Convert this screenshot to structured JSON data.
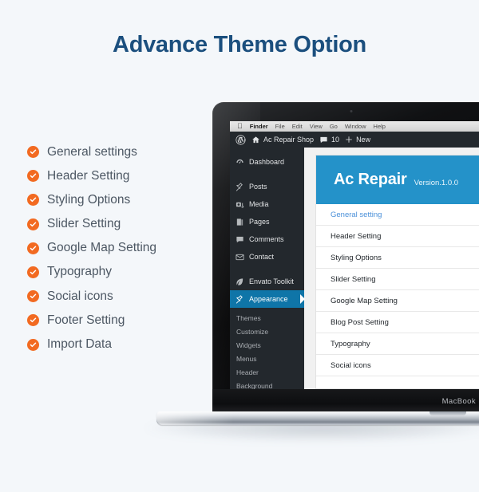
{
  "header": {
    "title": "Advance Theme Option"
  },
  "features": {
    "icon": "check-circle-icon",
    "items": [
      {
        "label": "General settings"
      },
      {
        "label": "Header Setting"
      },
      {
        "label": "Styling Options"
      },
      {
        "label": "Slider Setting"
      },
      {
        "label": "Google Map Setting"
      },
      {
        "label": "Typography"
      },
      {
        "label": "Social icons"
      },
      {
        "label": "Footer Setting"
      },
      {
        "label": "Import Data"
      }
    ]
  },
  "device": {
    "model_label": "MacBook"
  },
  "mac_menubar": {
    "apple": "",
    "items": [
      "Finder",
      "File",
      "Edit",
      "View",
      "Go",
      "Window",
      "Help"
    ]
  },
  "wp_adminbar": {
    "site_name": "Ac Repair Shop",
    "comment_count": "10",
    "new_label": "New"
  },
  "wp_sidebar": {
    "items": [
      {
        "label": "Dashboard",
        "icon": "dashboard-icon"
      },
      {
        "label": "Posts",
        "icon": "pin-icon"
      },
      {
        "label": "Media",
        "icon": "media-icon"
      },
      {
        "label": "Pages",
        "icon": "pages-icon"
      },
      {
        "label": "Comments",
        "icon": "comment-icon"
      },
      {
        "label": "Contact",
        "icon": "envelope-icon"
      },
      {
        "label": "Envato Toolkit",
        "icon": "leaf-icon"
      },
      {
        "label": "Appearance",
        "icon": "brush-icon",
        "active": true
      }
    ],
    "submenu": [
      "Themes",
      "Customize",
      "Widgets",
      "Menus",
      "Header",
      "Background"
    ]
  },
  "theme_panel": {
    "name": "Ac Repair",
    "version": "Version.1.0.0",
    "options": [
      {
        "label": "General setting",
        "active": true
      },
      {
        "label": "Header Setting"
      },
      {
        "label": "Styling Options"
      },
      {
        "label": "Slider Setting"
      },
      {
        "label": "Google Map Setting"
      },
      {
        "label": "Blog Post Setting"
      },
      {
        "label": "Typography"
      },
      {
        "label": "Social icons"
      }
    ]
  },
  "colors": {
    "background": "#f4f7fa",
    "title": "#1b4f7e",
    "accent_orange": "#f26a21",
    "banner_blue": "#2492c9",
    "active_menu_blue": "#0f75a8",
    "sidebar_dark": "#23282d",
    "link_blue": "#4a90d9"
  }
}
